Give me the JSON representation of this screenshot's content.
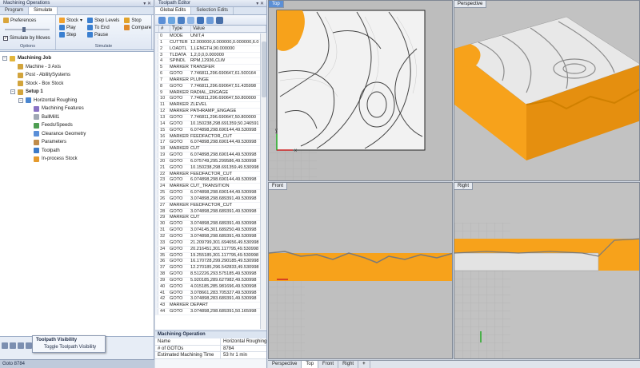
{
  "left_panel": {
    "title": "Machining Operations",
    "tabs": [
      "Program",
      "Simulate"
    ],
    "ribbon": {
      "preferences": "Preferences",
      "simulate_by_moves": "Simulate by Moves",
      "options_group": "Options",
      "stock": "Stock",
      "play": "Play",
      "step": "Step",
      "step_levels": "Step Levels",
      "to_end": "To End",
      "pause": "Pause",
      "stop": "Stop",
      "compare": "Compare",
      "simulate_group": "Simulate"
    },
    "tree": {
      "job": "Machining Job",
      "machine": "Machine - 3 Axis",
      "post": "Post - AbilitySystems",
      "stock": "Stock - Box Stock",
      "setup": "Setup 1",
      "operation": "Horizontal Roughing",
      "features": "Machining Features",
      "tool": "BallMill1",
      "feeds": "Feeds/Speeds",
      "clearance": "Clearance Geometry",
      "parameters": "Parameters",
      "toolpath": "Toolpath",
      "inprocess": "In-process Stock"
    },
    "tooltip": {
      "title": "Toolpath Visibility",
      "item": "Toggle Toolpath Visibility"
    },
    "status": "Goto 8784"
  },
  "toolpath_editor": {
    "title": "Toolpath Editor",
    "tabs": [
      "Global Edits",
      "Selection Edits"
    ],
    "columns": [
      "#",
      "Type",
      "Value"
    ],
    "rows": [
      [
        "0",
        "MODE",
        "UNIT,4"
      ],
      [
        "1",
        "CUTTER",
        "12.000000,6.000000,0.000000,6.0"
      ],
      [
        "2",
        "LOADTL",
        "1,LENGTH,90.000000"
      ],
      [
        "3",
        "TLDATA",
        "1,2,0,0,0.000000"
      ],
      [
        "4",
        "SPINDL",
        "RPM,12936,CLW"
      ],
      [
        "5",
        "MARKER",
        "TRANSFER"
      ],
      [
        "6",
        "GOTO",
        "7.746811,296.690647,61.500164"
      ],
      [
        "7",
        "MARKER",
        "PLUNGE"
      ],
      [
        "8",
        "GOTO",
        "7.746811,296.690647,51.435998"
      ],
      [
        "9",
        "MARKER",
        "RADIAL_ENGAGE"
      ],
      [
        "10",
        "GOTO",
        "7.746811,296.690647,50.800000"
      ],
      [
        "11",
        "MARKER",
        "ZLEVEL"
      ],
      [
        "12",
        "MARKER",
        "PATHRAMP_ENGAGE"
      ],
      [
        "13",
        "GOTO",
        "7.746811,296.690647,50.800000"
      ],
      [
        "14",
        "GOTO",
        "10.150238,298.691359,50.246591"
      ],
      [
        "15",
        "GOTO",
        "6.074898,298.690144,49.530998"
      ],
      [
        "16",
        "MARKER",
        "FEEDFACTOR_CUT"
      ],
      [
        "17",
        "GOTO",
        "6.074898,298.690144,49.530998"
      ],
      [
        "18",
        "MARKER",
        "CUT"
      ],
      [
        "19",
        "GOTO",
        "6.074898,298.690144,49.530998"
      ],
      [
        "20",
        "GOTO",
        "6.075749,295.299586,49.530998"
      ],
      [
        "21",
        "GOTO",
        "10.150238,298.691359,49.530998"
      ],
      [
        "22",
        "MARKER",
        "FEEDFACTOR_CUT"
      ],
      [
        "23",
        "GOTO",
        "6.074898,298.690144,49.530998"
      ],
      [
        "24",
        "MARKER",
        "CUT_TRANSITION"
      ],
      [
        "25",
        "GOTO",
        "6.074898,298.690144,49.530998"
      ],
      [
        "26",
        "GOTO",
        "3.074898,298.689391,49.530998"
      ],
      [
        "27",
        "MARKER",
        "FEEDFACTOR_CUT"
      ],
      [
        "28",
        "GOTO",
        "3.074898,298.689391,49.530998"
      ],
      [
        "29",
        "MARKER",
        "CUT"
      ],
      [
        "30",
        "GOTO",
        "3.074898,298.689391,49.530998"
      ],
      [
        "31",
        "GOTO",
        "3.074145,301.689250,49.530998"
      ],
      [
        "32",
        "GOTO",
        "3.074898,298.689391,49.530998"
      ],
      [
        "33",
        "GOTO",
        "21.209799,301.694656,49.530998"
      ],
      [
        "34",
        "GOTO",
        "20.216451,301.117795,49.530998"
      ],
      [
        "35",
        "GOTO",
        "19.255185,301.117795,49.530998"
      ],
      [
        "36",
        "GOTO",
        "16.170728,299.290185,49.530998"
      ],
      [
        "37",
        "GOTO",
        "12.270185,296.542833,49.530998"
      ],
      [
        "38",
        "GOTO",
        "8.512226,293.575185,49.530998"
      ],
      [
        "39",
        "GOTO",
        "5.920185,289.627982,49.530998"
      ],
      [
        "40",
        "GOTO",
        "4.015185,285.981696,49.530998"
      ],
      [
        "41",
        "GOTO",
        "3.078661,283.705327,49.530998"
      ],
      [
        "42",
        "GOTO",
        "3.074898,283.689391,49.530998"
      ],
      [
        "43",
        "MARKER",
        "DEPART"
      ],
      [
        "44",
        "GOTO",
        "3.074898,298.689391,50.165998"
      ]
    ],
    "machining_operation": {
      "header": "Machining Operation",
      "props": [
        [
          "Name",
          "Horizontal Roughing"
        ],
        [
          "# of GOTOs",
          "8784"
        ],
        [
          "Estimated Machining Time",
          "53 hr 1 min"
        ]
      ]
    }
  },
  "viewports": {
    "top": "Top",
    "perspective": "Perspective",
    "front": "Front",
    "right": "Right",
    "axis_x": "x",
    "axis_y": "y",
    "axis_z": "z"
  },
  "view_tabs": [
    "Perspective",
    "Top",
    "Front",
    "Right",
    "+"
  ],
  "colors": {
    "stock": "#f7a21b",
    "surface": "#ececec",
    "accent": "#5b8fd6"
  }
}
